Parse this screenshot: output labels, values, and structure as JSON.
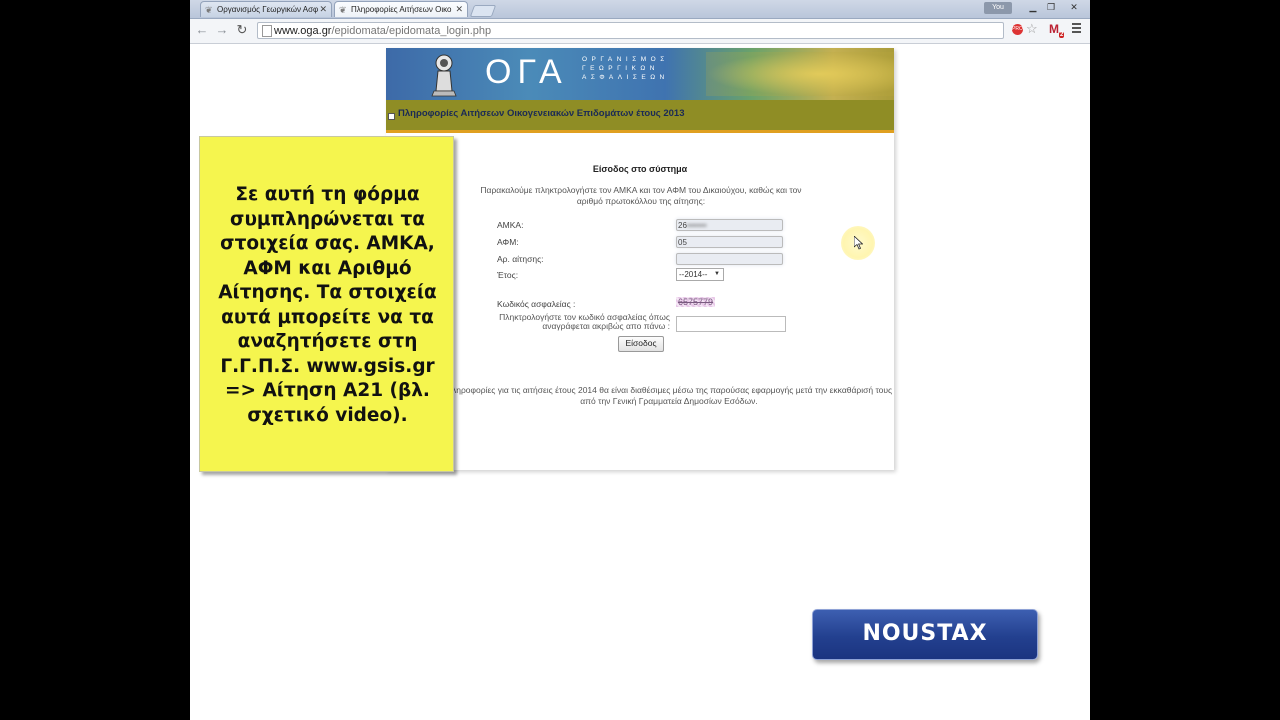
{
  "browser": {
    "tabs": [
      {
        "label": "Οργανισμός Γεωργικών Ασφ",
        "active": false
      },
      {
        "label": "Πληροφορίες Αιτήσεων Οικο",
        "active": true
      }
    ],
    "user_badge": "You",
    "url_domain": "www.oga.gr",
    "url_path": "/epidomata/epidomata_login.php",
    "ext_badge": "PRO",
    "mail_count": "2"
  },
  "site": {
    "logo_text": "ΟΓΑ",
    "org_name": "ΟΡΓΑΝΙΣΜΟΣ ΓΕΩΡΓΙΚΩΝ ΑΣΦΑΛΙΣΕΩΝ",
    "title": "Πληροφορίες Αιτήσεων Οικογενειακών Επιδομάτων έτους 2013"
  },
  "login_form": {
    "heading": "Είσοδος στο σύστημα",
    "instructions": "Παρακαλούμε πληκτρολογήστε τον ΑΜΚΑ και τον ΑΦΜ του Δικαιούχου, καθώς και τον αριθμό πρωτοκόλλου της αίτησης:",
    "amka_label": "ΑΜΚΑ:",
    "amka_value": "26",
    "afm_label": "ΑΦΜ:",
    "afm_value": "05",
    "application_no_label": "Αρ. αίτησης:",
    "year_label": "Έτος:",
    "year_value": "--2014--",
    "security_code_label": "Κωδικός ασφαλείας :",
    "security_code": "6575779",
    "security_prompt": "Πληκτρολογήστε τον κωδικό ασφαλείας όπως αναγράφεται ακριβώς απο πάνω :",
    "submit_label": "Είσοδος",
    "footer_note": "Πληροφορίες για τις αιτήσεις έτους 2014 θα είναι διαθέσιμες μέσω της παρούσας εφαρμογής μετά την εκκαθάρισή τους από την Γενική Γραμματεία Δημοσίων Εσόδων."
  },
  "overlay": {
    "note": "Σε αυτή τη φόρμα συμπληρώνεται τα στοιχεία σας. ΑΜΚΑ, ΑΦΜ και Αριθμό Αίτησης. Τα στοιχεία αυτά μπορείτε να τα αναζητήσετε στη Γ.Γ.Π.Σ. www.gsis.gr => Αίτηση Α21 (βλ. σχετικό video).",
    "brand": "NOUSTAX"
  },
  "colors": {
    "note_bg": "#f5f54e",
    "title_bar": "#8f8d25",
    "brand_bg": "#23408f"
  }
}
